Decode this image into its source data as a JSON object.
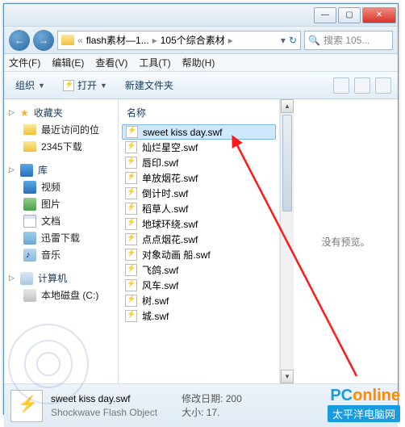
{
  "titlebar": {
    "min": "—",
    "max": "▢",
    "close": "✕"
  },
  "address": {
    "back": "←",
    "fwd": "→",
    "seg_icon": "📁",
    "seg1": "flash素材—1...",
    "seg2": "105个综合素材",
    "refresh": "↻",
    "search_placeholder": "搜索 105..."
  },
  "menu": {
    "file": "文件(F)",
    "edit": "编辑(E)",
    "view": "查看(V)",
    "tools": "工具(T)",
    "help": "帮助(H)"
  },
  "toolbar": {
    "organize": "组织",
    "open": "打开",
    "newfolder": "新建文件夹"
  },
  "sidebar": {
    "fav": "收藏夹",
    "fav_items": [
      "最近访问的位",
      "2345下载"
    ],
    "lib": "库",
    "lib_items": [
      "视频",
      "图片",
      "文档",
      "迅雷下载",
      "音乐"
    ],
    "computer": "计算机",
    "drives": [
      "本地磁盘 (C:)"
    ]
  },
  "list": {
    "col_name": "名称",
    "files": [
      "sweet kiss day.swf",
      "灿烂星空.swf",
      "唇印.swf",
      "单放烟花.swf",
      "倒计时.swf",
      "稻草人.swf",
      "地球环绕.swf",
      "点点烟花.swf",
      "对象动画 船.swf",
      "飞鸽.swf",
      "风车.swf",
      "树.swf",
      "城.swf"
    ],
    "selected_index": 0
  },
  "preview": {
    "nopreview": "没有预览。"
  },
  "status": {
    "name": "sweet kiss day.swf",
    "type": "Shockwave Flash Object",
    "date_label": "修改日期:",
    "date_val": "200",
    "size_label": "大小:",
    "size_val": "17."
  },
  "watermark": {
    "brand_pc": "PC",
    "brand_online": "online",
    "brand_cn": "太平洋电脑网"
  }
}
